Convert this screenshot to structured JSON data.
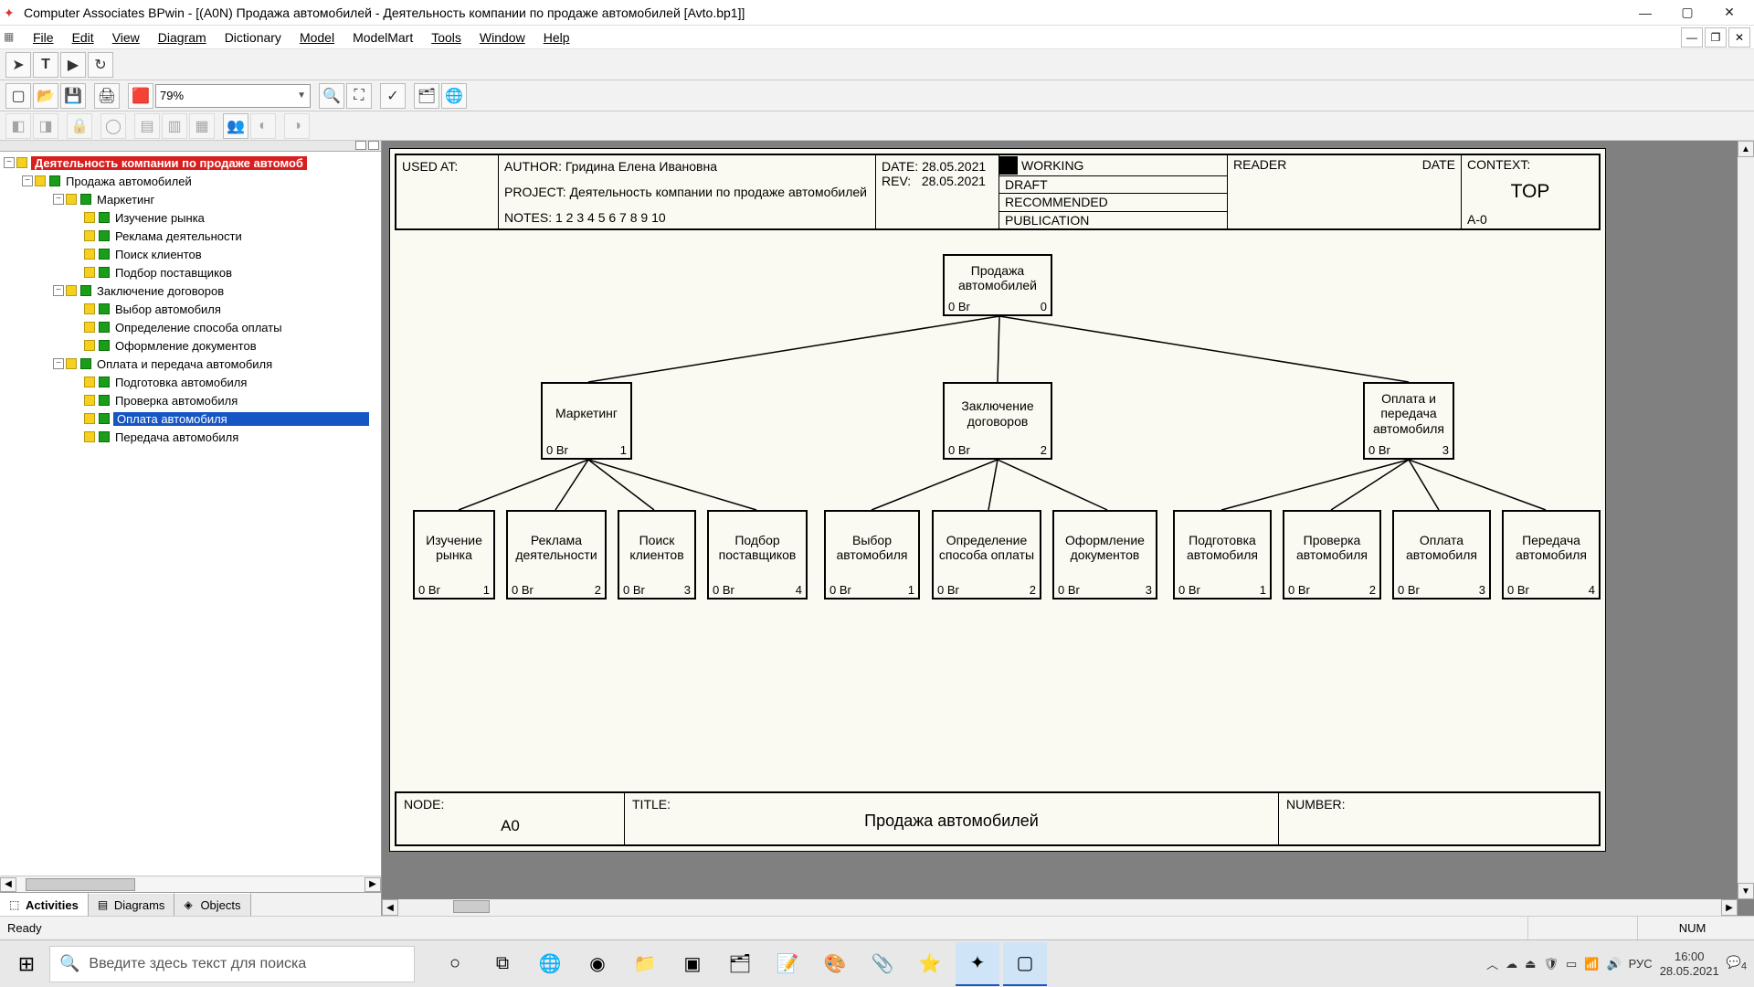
{
  "title": "Computer Associates BPwin - [(A0N) Продажа автомобилей - Деятельность компании по продаже автомобилей  [Avto.bp1]]",
  "menu": {
    "file": "File",
    "edit": "Edit",
    "view": "View",
    "diagram": "Diagram",
    "dictionary": "Dictionary",
    "model": "Model",
    "modelmart": "ModelMart",
    "tools": "Tools",
    "window": "Window",
    "help": "Help"
  },
  "toolbar": {
    "zoom": "79%"
  },
  "tree": {
    "root": "Деятельность компании по продаже автомоб",
    "n1": "Продажа автомобилей",
    "n2": "Маркетинг",
    "n2a": "Изучение рынка",
    "n2b": "Реклама деятельности",
    "n2c": "Поиск клиентов",
    "n2d": "Подбор поставщиков",
    "n3": "Заключение договоров",
    "n3a": "Выбор  автомобиля",
    "n3b": "Определение способа оплаты",
    "n3c": "Оформление документов",
    "n4": "Оплата и передача автомобиля",
    "n4a": "Подготовка автомобиля",
    "n4b": "Проверка автомобиля",
    "n4c": "Оплата автомобиля",
    "n4d": "Передача автомобиля"
  },
  "side_tabs": {
    "activities": "Activities",
    "diagrams": "Diagrams",
    "objects": "Objects"
  },
  "header": {
    "used_at": "USED AT:",
    "author": "AUTHOR:  Гридина Елена Ивановна",
    "project": "PROJECT:   Деятельность компании по продаже автомобилей",
    "notes": "NOTES:  1  2  3  4  5  6  7  8  9  10",
    "date_l": "DATE:",
    "date_v": "28.05.2021",
    "rev_l": "REV:",
    "rev_v": "28.05.2021",
    "working": "WORKING",
    "draft": "DRAFT",
    "recommended": "RECOMMENDED",
    "publication": "PUBLICATION",
    "reader": "READER",
    "hdr_date": "DATE",
    "context": "CONTEXT:",
    "top": "TOP",
    "a0": "A-0"
  },
  "footer": {
    "node": "NODE:",
    "node_v": "A0",
    "title": "TITLE:",
    "title_v": "Продажа автомобилей",
    "number": "NUMBER:"
  },
  "chart_data": {
    "type": "tree",
    "root": {
      "label": "Продажа автомобилей",
      "cost": "0 Br",
      "num": "0"
    },
    "level1": [
      {
        "label": "Маркетинг",
        "cost": "0 Br",
        "num": "1"
      },
      {
        "label": "Заключение договоров",
        "cost": "0 Br",
        "num": "2"
      },
      {
        "label": "Оплата и передача автомобиля",
        "cost": "0 Br",
        "num": "3"
      }
    ],
    "level2": [
      [
        {
          "label": "Изучение рынка",
          "cost": "0 Br",
          "num": "1"
        },
        {
          "label": "Реклама деятельности",
          "cost": "0 Br",
          "num": "2"
        },
        {
          "label": "Поиск клиентов",
          "cost": "0 Br",
          "num": "3"
        },
        {
          "label": "Подбор поставщиков",
          "cost": "0 Br",
          "num": "4"
        }
      ],
      [
        {
          "label": "Выбор автомобиля",
          "cost": "0 Br",
          "num": "1"
        },
        {
          "label": "Определение способа оплаты",
          "cost": "0 Br",
          "num": "2"
        },
        {
          "label": "Оформление документов",
          "cost": "0 Br",
          "num": "3"
        }
      ],
      [
        {
          "label": "Подготовка автомобиля",
          "cost": "0 Br",
          "num": "1"
        },
        {
          "label": "Проверка автомобиля",
          "cost": "0 Br",
          "num": "2"
        },
        {
          "label": "Оплата автомобиля",
          "cost": "0 Br",
          "num": "3"
        },
        {
          "label": "Передача автомобиля",
          "cost": "0 Br",
          "num": "4"
        }
      ]
    ]
  },
  "status": {
    "ready": "Ready",
    "num": "NUM"
  },
  "taskbar": {
    "search_placeholder": "Введите здесь текст для поиска",
    "lang": "РУС",
    "time": "16:00",
    "date": "28.05.2021",
    "notif": "4"
  }
}
